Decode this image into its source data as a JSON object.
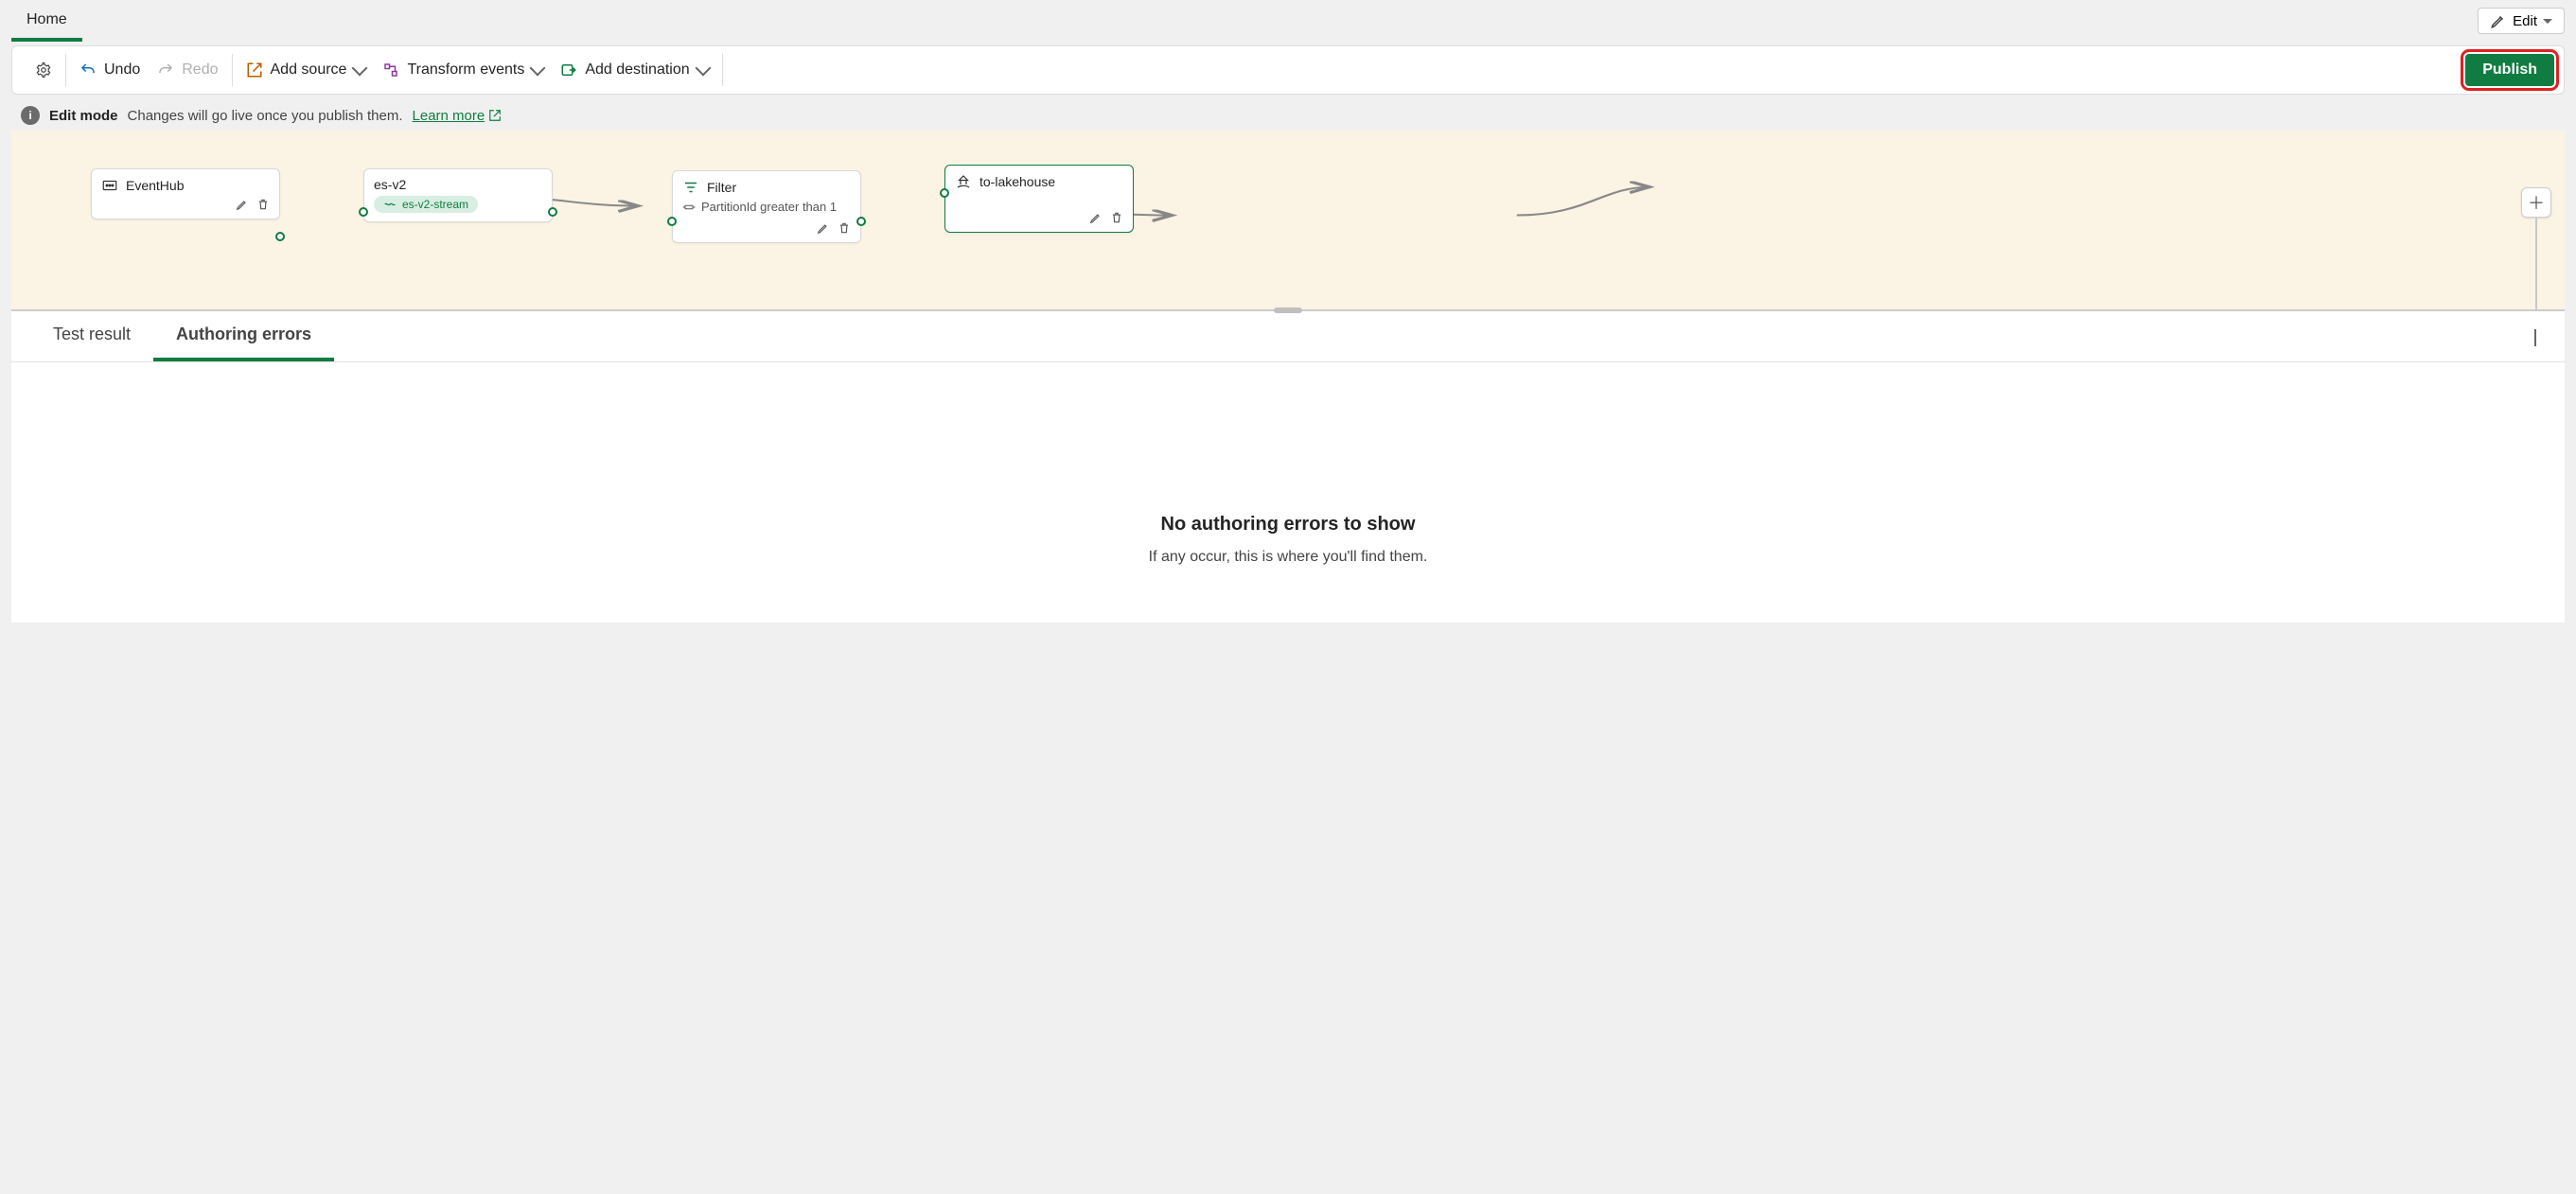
{
  "topTabs": {
    "home": "Home"
  },
  "editDropdown": "Edit",
  "toolbar": {
    "undo": "Undo",
    "redo": "Redo",
    "addSource": "Add source",
    "transformEvents": "Transform events",
    "addDestination": "Add destination",
    "publish": "Publish"
  },
  "infoBar": {
    "modeLabel": "Edit mode",
    "message": "Changes will go live once you publish them.",
    "learnMore": "Learn more"
  },
  "nodes": {
    "source": {
      "label": "EventHub"
    },
    "stream": {
      "label": "es-v2",
      "streamName": "es-v2-stream"
    },
    "filter": {
      "label": "Filter",
      "condition": "PartitionId greater than 1"
    },
    "destination": {
      "label": "to-lakehouse"
    }
  },
  "bottomTabs": {
    "testResult": "Test result",
    "authoringErrors": "Authoring errors"
  },
  "emptyState": {
    "title": "No authoring errors to show",
    "subtitle": "If any occur, this is where you'll find them."
  }
}
